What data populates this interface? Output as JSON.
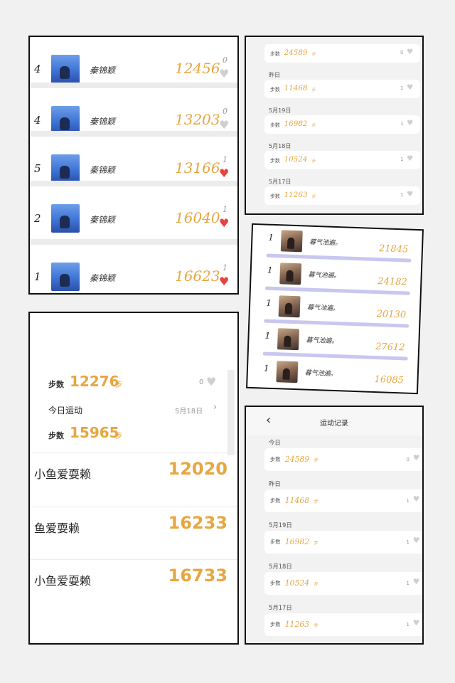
{
  "panel_a": {
    "rows": [
      {
        "rank": "4",
        "name": "秦锦颖",
        "steps": "12456",
        "likes": "0",
        "liked": false
      },
      {
        "rank": "4",
        "name": "秦锦颖",
        "steps": "13203",
        "likes": "0",
        "liked": false
      },
      {
        "rank": "5",
        "name": "秦锦颖",
        "steps": "13166",
        "likes": "1",
        "liked": true
      },
      {
        "rank": "2",
        "name": "秦锦颖",
        "steps": "16040",
        "likes": "1",
        "liked": true
      },
      {
        "rank": "1",
        "name": "秦锦颖",
        "steps": "16623",
        "likes": "1",
        "liked": true
      }
    ]
  },
  "panel_b": {
    "unit": "步",
    "items": [
      {
        "type": "row",
        "label": "步数",
        "value": "24589",
        "likes": "0"
      },
      {
        "type": "date",
        "text": "昨日"
      },
      {
        "type": "row",
        "label": "步数",
        "value": "11468",
        "likes": "1"
      },
      {
        "type": "date",
        "text": "5月19日"
      },
      {
        "type": "row",
        "label": "步数",
        "value": "16982",
        "likes": "1"
      },
      {
        "type": "date",
        "text": "5月18日"
      },
      {
        "type": "row",
        "label": "步数",
        "value": "10524",
        "likes": "1"
      },
      {
        "type": "date",
        "text": "5月17日"
      },
      {
        "type": "row",
        "label": "步数",
        "value": "11263",
        "likes": "1"
      }
    ]
  },
  "panel_c": {
    "rows": [
      {
        "rank": "1",
        "name": "暮气池遍。",
        "steps": "21845"
      },
      {
        "rank": "1",
        "name": "暮气池遍。",
        "steps": "24182"
      },
      {
        "rank": "1",
        "name": "暮气池遍。",
        "steps": "20130"
      },
      {
        "rank": "1",
        "name": "暮气池遍。",
        "steps": "27612"
      },
      {
        "rank": "1",
        "name": "暮气池遍。",
        "steps": "16085"
      }
    ]
  },
  "panel_d": {
    "steps_label": "步数",
    "steps_value_1": "12276",
    "steps_unit": "步",
    "likes_1": "0",
    "today_label": "今日运动",
    "today_date": "5月18日",
    "steps_value_2": "15965",
    "rows": [
      {
        "name": "小鱼爱耍赖",
        "steps": "12020"
      },
      {
        "name": "鱼爱耍赖",
        "steps": "16233"
      },
      {
        "name": "小鱼爱耍赖",
        "steps": "16733"
      }
    ]
  },
  "panel_e": {
    "title": "运动记录",
    "back_icon": "chevron-left-icon",
    "unit": "步",
    "items": [
      {
        "type": "date",
        "text": "今日"
      },
      {
        "type": "row",
        "label": "步数",
        "value": "24589",
        "likes": "0"
      },
      {
        "type": "date",
        "text": "昨日"
      },
      {
        "type": "row",
        "label": "步数",
        "value": "11468",
        "likes": "1"
      },
      {
        "type": "date",
        "text": "5月19日"
      },
      {
        "type": "row",
        "label": "步数",
        "value": "16982",
        "likes": "1"
      },
      {
        "type": "date",
        "text": "5月18日"
      },
      {
        "type": "row",
        "label": "步数",
        "value": "10524",
        "likes": "1"
      },
      {
        "type": "date",
        "text": "5月17日"
      },
      {
        "type": "row",
        "label": "步数",
        "value": "11263",
        "likes": "1"
      }
    ]
  },
  "colors": {
    "accent": "#e7a640",
    "heart": "#e8423f",
    "violet": "#c9c7f0"
  }
}
